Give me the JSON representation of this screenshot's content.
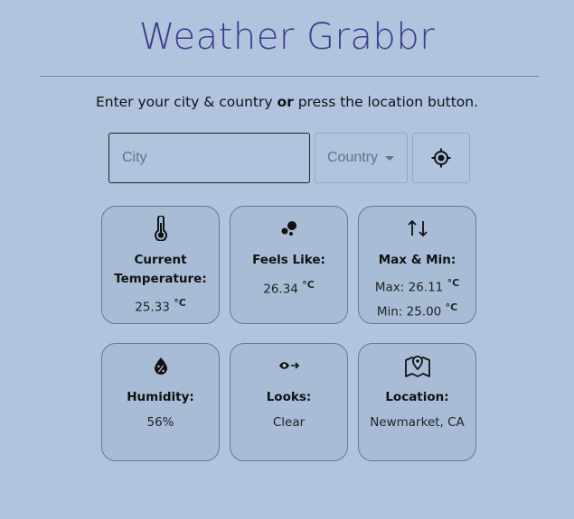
{
  "header": {
    "title": "Weather Grabbr"
  },
  "instructions": {
    "part1": "Enter your city & country ",
    "bold": "or",
    "part2": " press the location button."
  },
  "form": {
    "city_placeholder": "City",
    "city_value": "",
    "country_label": "Country",
    "location_icon": "my-location-icon"
  },
  "cards": {
    "current_temp": {
      "icon": "thermometer-icon",
      "label_line1": "Current",
      "label_line2": "Temperature:",
      "value": "25.33",
      "unit": "°C"
    },
    "feels_like": {
      "icon": "bubbles-icon",
      "label": "Feels Like:",
      "value": "26.34",
      "unit": "°C"
    },
    "max_min": {
      "icon": "swap-vertical-icon",
      "label": "Max & Min:",
      "max_label": "Max: 26.11",
      "min_label": "Min: 25.00",
      "unit": "°C"
    },
    "humidity": {
      "icon": "humidity-drop-icon",
      "label": "Humidity:",
      "value": "56%"
    },
    "looks": {
      "icon": "eye-arrow-icon",
      "label": "Looks:",
      "value": "Clear"
    },
    "location": {
      "icon": "map-pin-icon",
      "label": "Location:",
      "value": "Newmarket, CA"
    }
  },
  "colors": {
    "background": "#b0c4de",
    "title": "#3f3b8e",
    "card_border": "#6f7784"
  }
}
